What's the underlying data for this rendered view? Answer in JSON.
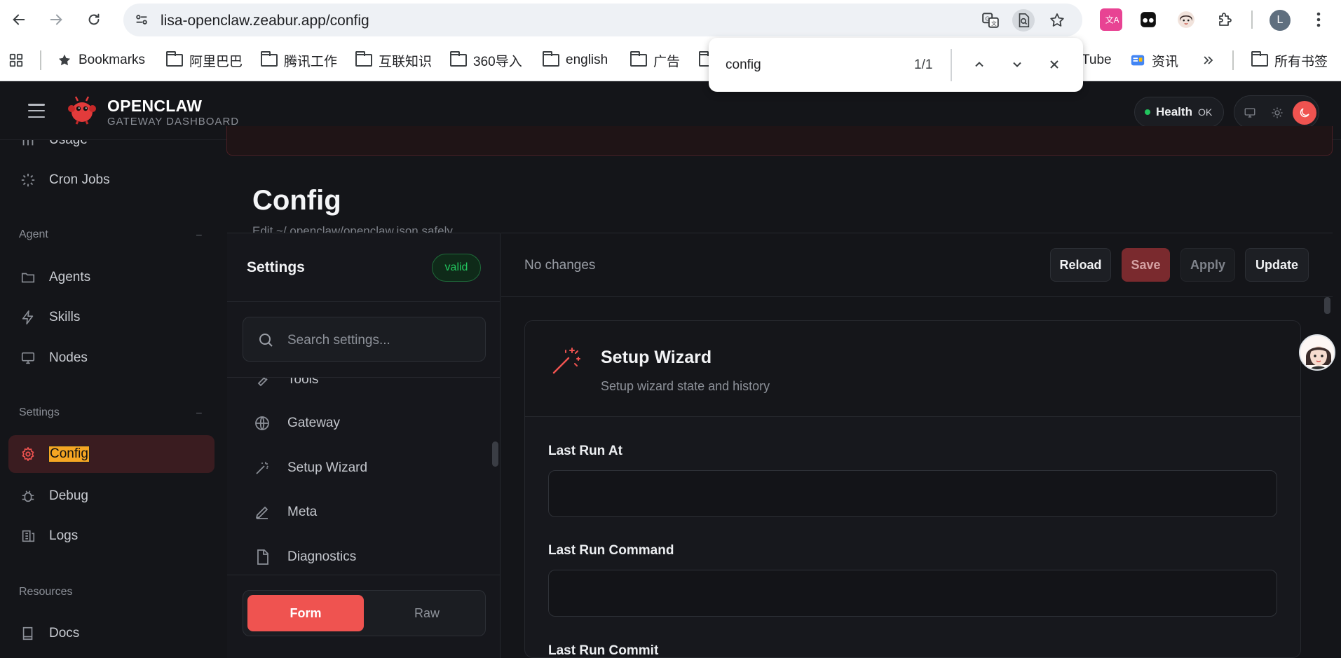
{
  "browser": {
    "url": "lisa-openclaw.zeabur.app/config",
    "profile_initial": "L",
    "bookmarks": [
      {
        "label": "Bookmarks",
        "icon": "star-icon"
      },
      {
        "label": "阿里巴巴",
        "icon": "folder-icon"
      },
      {
        "label": "腾讯工作",
        "icon": "folder-icon"
      },
      {
        "label": "互联知识",
        "icon": "folder-icon"
      },
      {
        "label": "360导入",
        "icon": "folder-icon"
      },
      {
        "label": "english",
        "icon": "folder-icon"
      },
      {
        "label": "广告",
        "icon": "folder-icon"
      },
      {
        "label": "Tube",
        "icon": "youtube-icon"
      },
      {
        "label": "资讯",
        "icon": "news-icon"
      },
      {
        "label": "所有书签",
        "icon": "folder-icon"
      }
    ],
    "find": {
      "query": "config",
      "count": "1/1"
    }
  },
  "header": {
    "brand": "OPENCLAW",
    "subtitle": "GATEWAY DASHBOARD",
    "health_label": "Health",
    "health_value": "OK",
    "accent": "#ef5350"
  },
  "sidebar": {
    "top_items": [
      {
        "label": "Usage",
        "icon": "chart-icon"
      },
      {
        "label": "Cron Jobs",
        "icon": "loader-icon"
      }
    ],
    "agent_section": "Agent",
    "agent_items": [
      {
        "label": "Agents",
        "icon": "folder-icon"
      },
      {
        "label": "Skills",
        "icon": "zap-icon"
      },
      {
        "label": "Nodes",
        "icon": "monitor-icon"
      }
    ],
    "settings_section": "Settings",
    "settings_items": [
      {
        "label": "Config",
        "icon": "gear-icon",
        "active": true
      },
      {
        "label": "Debug",
        "icon": "bug-icon"
      },
      {
        "label": "Logs",
        "icon": "logs-icon"
      }
    ],
    "resources_section": "Resources",
    "resources_items": [
      {
        "label": "Docs",
        "icon": "book-icon"
      }
    ],
    "collapse_symbol": "–"
  },
  "page": {
    "title": "Config",
    "subtitle": "Edit ~/.openclaw/openclaw.json safely."
  },
  "settings": {
    "heading": "Settings",
    "status": "valid",
    "search_placeholder": "Search settings...",
    "sections": [
      {
        "label": "Tools",
        "icon": "wrench-icon"
      },
      {
        "label": "Gateway",
        "icon": "globe-icon"
      },
      {
        "label": "Setup Wizard",
        "icon": "wand-icon"
      },
      {
        "label": "Meta",
        "icon": "pencil-icon"
      },
      {
        "label": "Diagnostics",
        "icon": "file-icon"
      }
    ],
    "mode_form": "Form",
    "mode_raw": "Raw"
  },
  "toolbar": {
    "status": "No changes",
    "reload": "Reload",
    "save": "Save",
    "apply": "Apply",
    "update": "Update"
  },
  "card": {
    "title": "Setup Wizard",
    "description": "Setup wizard state and history",
    "fields": [
      {
        "label": "Last Run At",
        "value": ""
      },
      {
        "label": "Last Run Command",
        "value": ""
      },
      {
        "label": "Last Run Commit",
        "value": ""
      }
    ]
  }
}
